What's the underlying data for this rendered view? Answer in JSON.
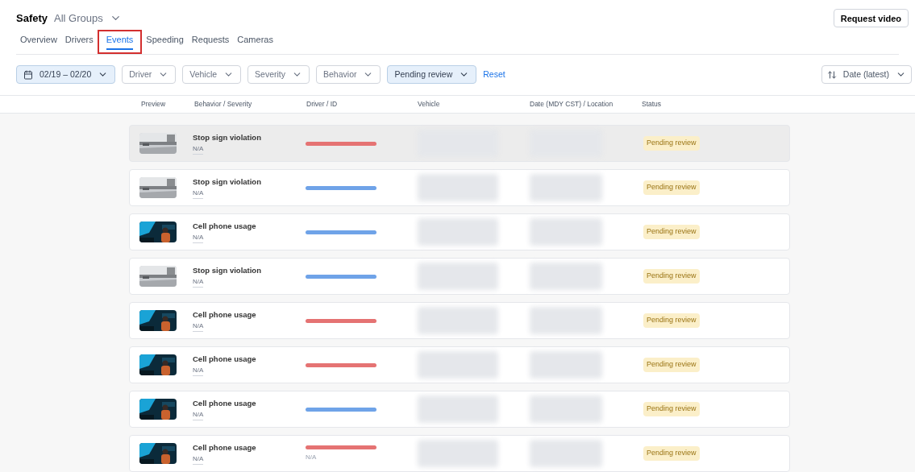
{
  "header": {
    "title": "Safety",
    "group": "All Groups",
    "request_button": "Request video"
  },
  "tabs": [
    {
      "label": "Overview",
      "selected": false,
      "highlighted": false
    },
    {
      "label": "Drivers",
      "selected": false,
      "highlighted": false
    },
    {
      "label": "Events",
      "selected": true,
      "highlighted": true
    },
    {
      "label": "Speeding",
      "selected": false,
      "highlighted": false
    },
    {
      "label": "Requests",
      "selected": false,
      "highlighted": false
    },
    {
      "label": "Cameras",
      "selected": false,
      "highlighted": false
    }
  ],
  "filters": [
    {
      "label": "02/19 – 02/20",
      "active": true,
      "kind": "date"
    },
    {
      "label": "Driver",
      "active": false,
      "kind": "plain"
    },
    {
      "label": "Vehicle",
      "active": false,
      "kind": "plain"
    },
    {
      "label": "Severity",
      "active": false,
      "kind": "plain"
    },
    {
      "label": "Behavior",
      "active": false,
      "kind": "plain"
    },
    {
      "label": "Pending review",
      "active": true,
      "kind": "plain"
    }
  ],
  "reset": "Reset",
  "sort": "Date (latest)",
  "table": {
    "columns": [
      "Preview",
      "Behavior / Severity",
      "Driver / ID",
      "Vehicle",
      "Date (MDY CST) / Location",
      "Status"
    ],
    "rows": [
      {
        "selected": true,
        "kind": "road",
        "behavior": "Stop sign violation",
        "severity": "N/A",
        "color": "#e57373",
        "status": "Pending review"
      },
      {
        "selected": false,
        "kind": "road",
        "behavior": "Stop sign violation",
        "severity": "N/A",
        "color": "#6fa3e8",
        "status": "Pending review"
      },
      {
        "selected": false,
        "kind": "cabin",
        "behavior": "Cell phone usage",
        "severity": "N/A",
        "color": "#6fa3e8",
        "status": "Pending review"
      },
      {
        "selected": false,
        "kind": "road",
        "behavior": "Stop sign violation",
        "severity": "N/A",
        "color": "#6fa3e8",
        "status": "Pending review"
      },
      {
        "selected": false,
        "kind": "cabin",
        "behavior": "Cell phone usage",
        "severity": "N/A",
        "color": "#e57373",
        "status": "Pending review"
      },
      {
        "selected": false,
        "kind": "cabin",
        "behavior": "Cell phone usage",
        "severity": "N/A",
        "color": "#e57373",
        "status": "Pending review"
      },
      {
        "selected": false,
        "kind": "cabin",
        "behavior": "Cell phone usage",
        "severity": "N/A",
        "color": "#6fa3e8",
        "status": "Pending review"
      },
      {
        "selected": false,
        "kind": "cabin",
        "behavior": "Cell phone usage",
        "severity": "N/A",
        "color": "#e57373",
        "status": "Pending review",
        "driver_id": "N/A"
      }
    ]
  }
}
